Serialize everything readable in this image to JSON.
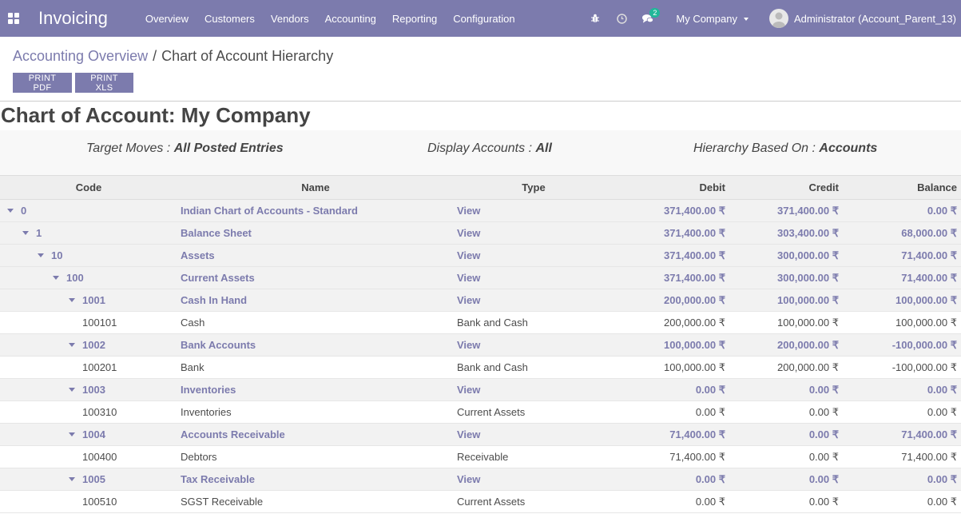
{
  "topbar": {
    "app_title": "Invoicing",
    "menu": [
      "Overview",
      "Customers",
      "Vendors",
      "Accounting",
      "Reporting",
      "Configuration"
    ],
    "icons": [
      "bug-icon",
      "clock-icon",
      "chat-icon"
    ],
    "message_count": "2",
    "company": "My Company",
    "user": "Administrator (Account_Parent_13)",
    "color": "#7c7bad"
  },
  "breadcrumb": {
    "parent": "Accounting Overview",
    "separator": "/",
    "current": "Chart of Account Hierarchy"
  },
  "buttons": {
    "print_pdf": "PRINT PDF",
    "print_xls": "PRINT XLS"
  },
  "report": {
    "title": "Chart of Account: My Company",
    "filters": [
      {
        "label": "Target Moves : ",
        "value": "All Posted Entries"
      },
      {
        "label": "Display Accounts : ",
        "value": "All"
      },
      {
        "label": "Hierarchy Based On : ",
        "value": "Accounts"
      }
    ],
    "columns": [
      "Code",
      "Name",
      "Type",
      "Debit",
      "Credit",
      "Balance"
    ],
    "rows": [
      {
        "level": 0,
        "group": true,
        "code": "0",
        "name": "Indian Chart of Accounts - Standard",
        "type": "View",
        "debit": "371,400.00 ₹",
        "credit": "371,400.00 ₹",
        "balance": "0.00 ₹"
      },
      {
        "level": 1,
        "group": true,
        "code": "1",
        "name": "Balance Sheet",
        "type": "View",
        "debit": "371,400.00 ₹",
        "credit": "303,400.00 ₹",
        "balance": "68,000.00 ₹"
      },
      {
        "level": 2,
        "group": true,
        "code": "10",
        "name": "Assets",
        "type": "View",
        "debit": "371,400.00 ₹",
        "credit": "300,000.00 ₹",
        "balance": "71,400.00 ₹"
      },
      {
        "level": 3,
        "group": true,
        "code": "100",
        "name": "Current Assets",
        "type": "View",
        "debit": "371,400.00 ₹",
        "credit": "300,000.00 ₹",
        "balance": "71,400.00 ₹"
      },
      {
        "level": 4,
        "group": true,
        "code": "1001",
        "name": "Cash In Hand",
        "type": "View",
        "debit": "200,000.00 ₹",
        "credit": "100,000.00 ₹",
        "balance": "100,000.00 ₹"
      },
      {
        "level": 5,
        "group": false,
        "code": "100101",
        "name": "Cash",
        "type": "Bank and Cash",
        "debit": "200,000.00 ₹",
        "credit": "100,000.00 ₹",
        "balance": "100,000.00 ₹"
      },
      {
        "level": 4,
        "group": true,
        "code": "1002",
        "name": "Bank Accounts",
        "type": "View",
        "debit": "100,000.00 ₹",
        "credit": "200,000.00 ₹",
        "balance": "-100,000.00 ₹"
      },
      {
        "level": 5,
        "group": false,
        "code": "100201",
        "name": "Bank",
        "type": "Bank and Cash",
        "debit": "100,000.00 ₹",
        "credit": "200,000.00 ₹",
        "balance": "-100,000.00 ₹"
      },
      {
        "level": 4,
        "group": true,
        "code": "1003",
        "name": "Inventories",
        "type": "View",
        "debit": "0.00 ₹",
        "credit": "0.00 ₹",
        "balance": "0.00 ₹"
      },
      {
        "level": 5,
        "group": false,
        "code": "100310",
        "name": "Inventories",
        "type": "Current Assets",
        "debit": "0.00 ₹",
        "credit": "0.00 ₹",
        "balance": "0.00 ₹"
      },
      {
        "level": 4,
        "group": true,
        "code": "1004",
        "name": "Accounts Receivable",
        "type": "View",
        "debit": "71,400.00 ₹",
        "credit": "0.00 ₹",
        "balance": "71,400.00 ₹"
      },
      {
        "level": 5,
        "group": false,
        "code": "100400",
        "name": "Debtors",
        "type": "Receivable",
        "debit": "71,400.00 ₹",
        "credit": "0.00 ₹",
        "balance": "71,400.00 ₹"
      },
      {
        "level": 4,
        "group": true,
        "code": "1005",
        "name": "Tax Receivable",
        "type": "View",
        "debit": "0.00 ₹",
        "credit": "0.00 ₹",
        "balance": "0.00 ₹"
      },
      {
        "level": 5,
        "group": false,
        "code": "100510",
        "name": "SGST Receivable",
        "type": "Current Assets",
        "debit": "0.00 ₹",
        "credit": "0.00 ₹",
        "balance": "0.00 ₹"
      }
    ]
  }
}
